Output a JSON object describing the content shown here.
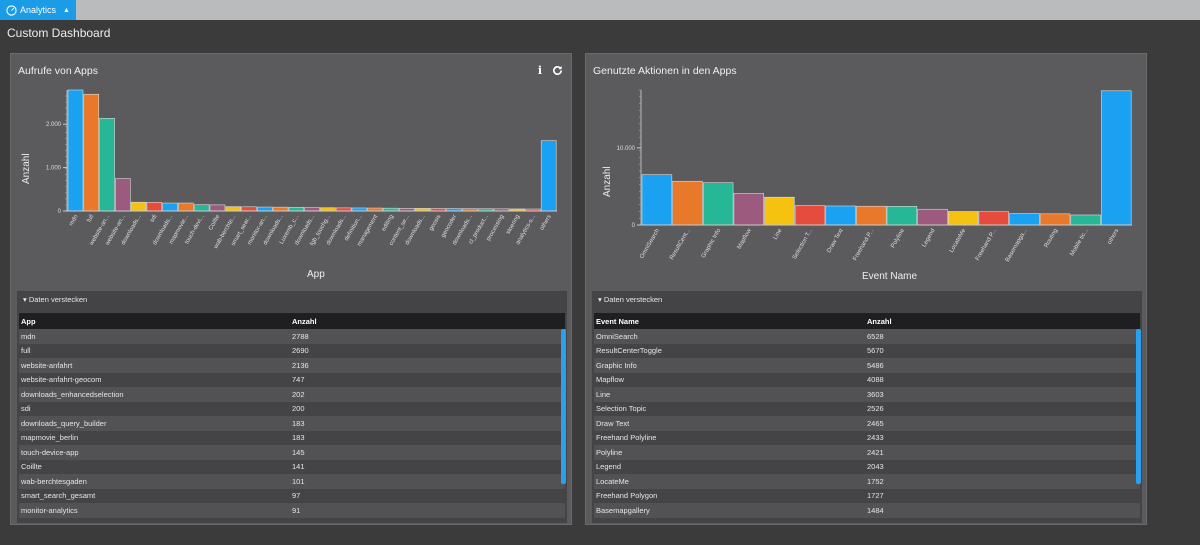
{
  "topbar": {
    "tab_label": "Analytics",
    "tab_icon": "dashboard-gauge-icon",
    "tab_caret": "▲"
  },
  "page": {
    "title": "Custom Dashboard"
  },
  "panels": [
    {
      "title": "Aufrufe von Apps",
      "show_actions": true,
      "actions": {
        "info": "i",
        "refresh": "refresh-icon"
      },
      "toggle_label": "▾ Daten verstecken",
      "table": {
        "headers": [
          "App",
          "Anzahl"
        ],
        "rows": [
          [
            "mdn",
            "2788"
          ],
          [
            "full",
            "2690"
          ],
          [
            "website-anfahrt",
            "2136"
          ],
          [
            "website-anfahrt-geocom",
            "747"
          ],
          [
            "downloads_enhancedselection",
            "202"
          ],
          [
            "sdi",
            "200"
          ],
          [
            "downloads_query_builder",
            "183"
          ],
          [
            "mapmovie_berlin",
            "183"
          ],
          [
            "touch-device-app",
            "145"
          ],
          [
            "Coillte",
            "141"
          ],
          [
            "wab-berchtesgaden",
            "101"
          ],
          [
            "smart_search_gesamt",
            "97"
          ],
          [
            "monitor-analytics",
            "91"
          ]
        ]
      }
    },
    {
      "title": "Genutzte Aktionen in den Apps",
      "show_actions": false,
      "toggle_label": "▾ Daten verstecken",
      "table": {
        "headers": [
          "Event Name",
          "Anzahl"
        ],
        "rows": [
          [
            "OmniSearch",
            "6528"
          ],
          [
            "ResultCenterToggle",
            "5670"
          ],
          [
            "Graphic Info",
            "5486"
          ],
          [
            "Mapflow",
            "4088"
          ],
          [
            "Line",
            "3603"
          ],
          [
            "Selection Topic",
            "2526"
          ],
          [
            "Draw Text",
            "2465"
          ],
          [
            "Freehand Polyline",
            "2433"
          ],
          [
            "Polyline",
            "2421"
          ],
          [
            "Legend",
            "2043"
          ],
          [
            "LocateMe",
            "1752"
          ],
          [
            "Freehand Polygon",
            "1727"
          ],
          [
            "Basemapgallery",
            "1484"
          ]
        ]
      }
    }
  ],
  "palette": [
    "#1ba1f2",
    "#e8782a",
    "#26b896",
    "#9b5a7e",
    "#f5c20f",
    "#e64c3c"
  ],
  "chart_data": [
    {
      "type": "bar",
      "title": "Aufrufe von Apps",
      "xlabel": "App",
      "ylabel": "Anzahl",
      "ylim": [
        0,
        2788
      ],
      "yticks": [
        0,
        1000,
        2000
      ],
      "ytick_labels": [
        "0",
        "1.000",
        "2.000"
      ],
      "categories": [
        "mdn",
        "full",
        "website-an...",
        "website-an...",
        "downloads...",
        "sdi",
        "downloads...",
        "mapmovie...",
        "touch-devi...",
        "Coillte",
        "wab-berchte...",
        "smart_sear...",
        "monitor-an...",
        "downloads...",
        "Luxemb_c...",
        "downloads...",
        "fgb_touchg...",
        "downloads...",
        "definition...",
        "management",
        "editing",
        "content_se...",
        "downloads...",
        "geosis",
        "geocoder",
        "downloads...",
        "cl_product...",
        "processing",
        "stoering",
        "analytics-s...",
        "others"
      ],
      "values": [
        2788,
        2690,
        2136,
        747,
        202,
        200,
        183,
        183,
        145,
        141,
        101,
        97,
        91,
        88,
        85,
        80,
        76,
        72,
        70,
        68,
        65,
        62,
        60,
        58,
        56,
        54,
        52,
        50,
        48,
        46,
        1620
      ]
    },
    {
      "type": "bar",
      "title": "Genutzte Aktionen in den Apps",
      "xlabel": "Event Name",
      "ylabel": "Anzahl",
      "ylim": [
        0,
        17500
      ],
      "yticks": [
        0,
        10000
      ],
      "ytick_labels": [
        "0",
        "10.000"
      ],
      "categories": [
        "OmniSearch",
        "ResultCent...",
        "Graphic Info",
        "Mapflow",
        "Line",
        "Selection T...",
        "Draw Text",
        "Freehand P...",
        "Polyline",
        "Legend",
        "LocateMe",
        "Freehand P...",
        "Basemapga...",
        "Routing",
        "Mobile tic...",
        "others"
      ],
      "values": [
        6528,
        5670,
        5486,
        4088,
        3603,
        2526,
        2465,
        2433,
        2421,
        2043,
        1752,
        1727,
        1484,
        1450,
        1300,
        17400
      ]
    }
  ]
}
